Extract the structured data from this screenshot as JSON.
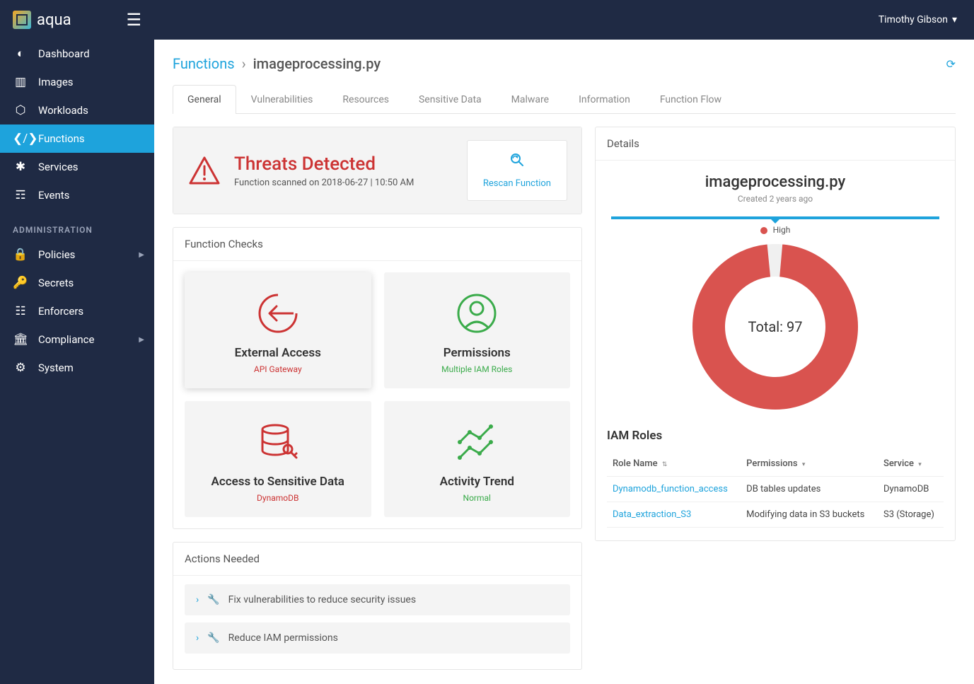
{
  "brand": "aqua",
  "user": "Timothy Gibson",
  "sidebar": {
    "items": [
      {
        "label": "Dashboard",
        "icon": "dashboard-icon"
      },
      {
        "label": "Images",
        "icon": "images-icon"
      },
      {
        "label": "Workloads",
        "icon": "workloads-icon"
      },
      {
        "label": "Functions",
        "icon": "functions-icon",
        "active": true
      },
      {
        "label": "Services",
        "icon": "services-icon"
      },
      {
        "label": "Events",
        "icon": "events-icon"
      }
    ],
    "admin_header": "ADMINISTRATION",
    "admin": [
      {
        "label": "Policies",
        "icon": "policies-icon",
        "submenu": true
      },
      {
        "label": "Secrets",
        "icon": "secrets-icon"
      },
      {
        "label": "Enforcers",
        "icon": "enforcers-icon"
      },
      {
        "label": "Compliance",
        "icon": "compliance-icon",
        "submenu": true
      },
      {
        "label": "System",
        "icon": "system-icon"
      }
    ]
  },
  "breadcrumb": {
    "root": "Functions",
    "leaf": "imageprocessing.py"
  },
  "tabs": [
    "General",
    "Vulnerabilities",
    "Resources",
    "Sensitive Data",
    "Malware",
    "Information",
    "Function Flow"
  ],
  "threat": {
    "title": "Threats Detected",
    "subtitle": "Function scanned on 2018-06-27 | 10:50 AM",
    "rescan": "Rescan Function"
  },
  "function_checks": {
    "title": "Function Checks",
    "cards": [
      {
        "title": "External Access",
        "sub": "API Gateway",
        "status": "red",
        "icon": "arrow-circle"
      },
      {
        "title": "Permissions",
        "sub": "Multiple IAM Roles",
        "status": "green",
        "icon": "user-circle"
      },
      {
        "title": "Access to Sensitive Data",
        "sub": "DynamoDB",
        "status": "red",
        "icon": "db-key"
      },
      {
        "title": "Activity Trend",
        "sub": "Normal",
        "status": "green",
        "icon": "trend"
      }
    ]
  },
  "actions": {
    "title": "Actions Needed",
    "items": [
      "Fix vulnerabilities to reduce security issues",
      "Reduce IAM permissions"
    ]
  },
  "details": {
    "panel_title": "Details",
    "name": "imageprocessing.py",
    "created": "Created 2 years ago",
    "legend": "High",
    "total_label": "Total: 97"
  },
  "chart_data": {
    "type": "pie",
    "title": "Total: 97",
    "series": [
      {
        "name": "High",
        "value": 97,
        "color": "#d9534f"
      }
    ],
    "total": 97,
    "note": "Donut chart with a small gap at the top (~3%) indicating near-complete High severity"
  },
  "iam": {
    "title": "IAM Roles",
    "columns": [
      "Role Name",
      "Permissions",
      "Service"
    ],
    "rows": [
      {
        "role": "Dynamodb_function_access",
        "perm": "DB tables updates",
        "svc": "DynamoDB"
      },
      {
        "role": "Data_extraction_S3",
        "perm": "Modifying data in S3 buckets",
        "svc": "S3 (Storage)"
      }
    ]
  }
}
